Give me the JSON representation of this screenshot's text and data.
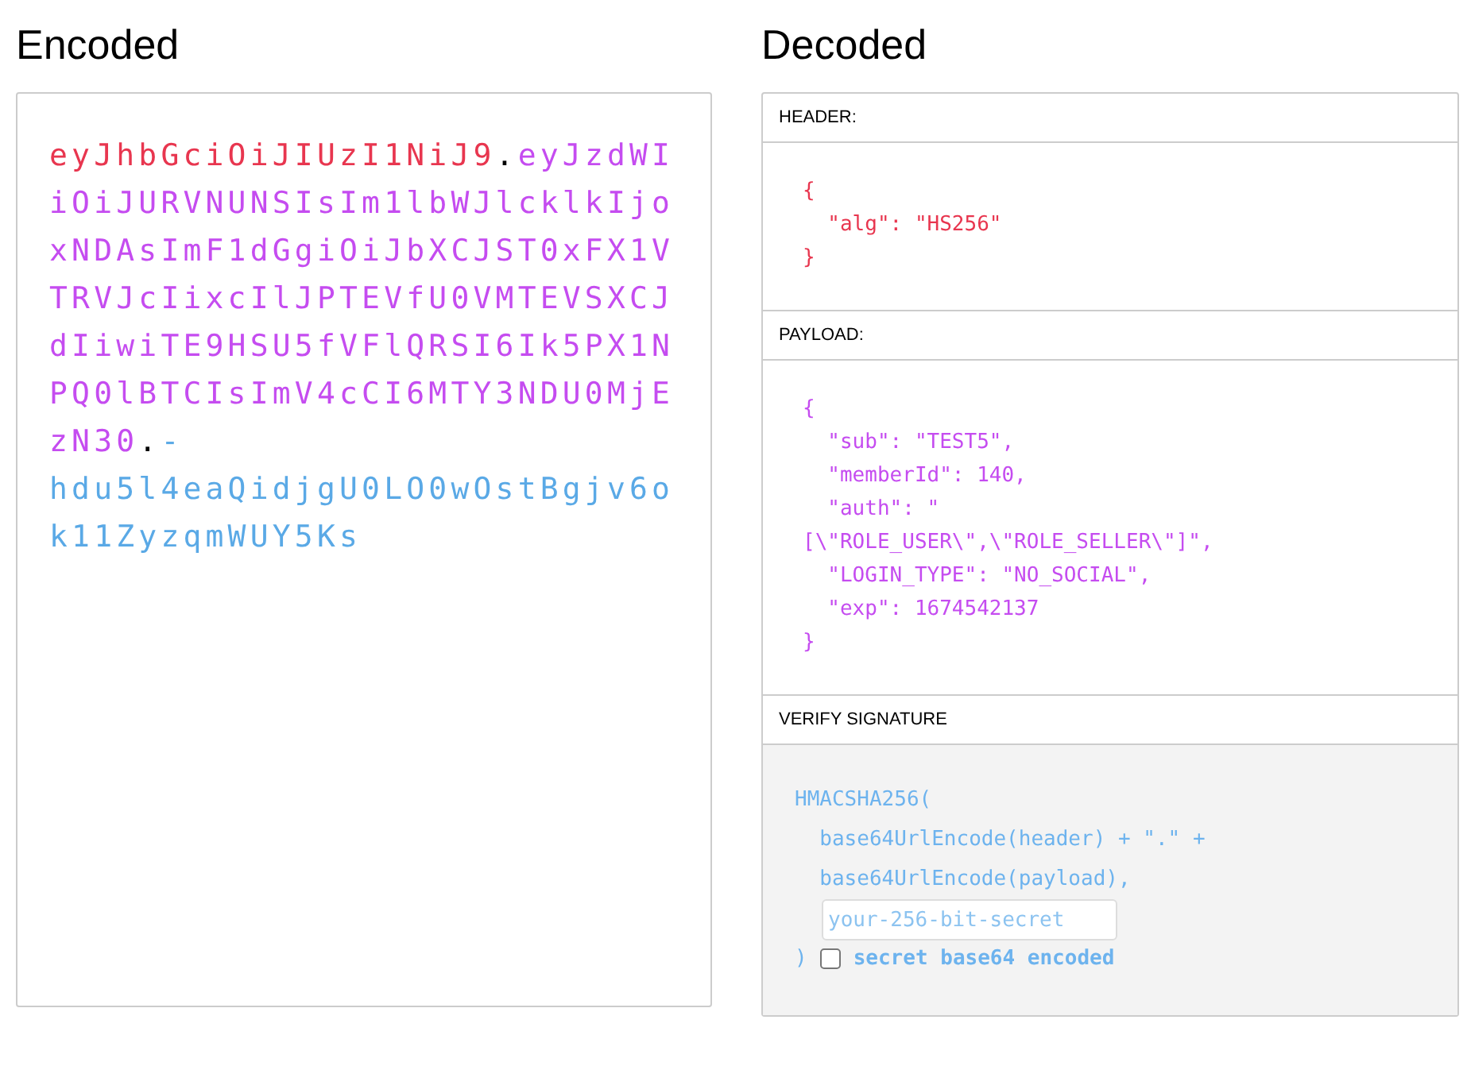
{
  "encoded": {
    "title": "Encoded",
    "segments": [
      {
        "kind": "header",
        "text": "eyJhbGciOiJIUzI1NiJ9"
      },
      {
        "kind": "dot",
        "text": "."
      },
      {
        "kind": "payload",
        "text": "eyJzdWIiOiJURVNUNSIsIm1lbWJlcklkIjoxNDAsImF1dGgiOiJbXCJST0xFX1VTRVJcIixcIlJPTEVfU0VMTEVSXCJdIiwiTE9HSU5fVFlQRSI6Ik5PX1NPQ0lBTCIsImV4cCI6MTY3NDU0MjEzN30"
      },
      {
        "kind": "dot",
        "text": "."
      },
      {
        "kind": "signature",
        "text": "-hdu5l4eaQidjgU0LO0wOstBgjv6ok11ZyzqmWUY5Ks"
      }
    ]
  },
  "decoded": {
    "title": "Decoded",
    "sections": [
      {
        "kind": "header",
        "label": "HEADER:",
        "lines": [
          "{",
          "  \"alg\": \"HS256\"",
          "}"
        ]
      },
      {
        "kind": "payload",
        "label": "PAYLOAD:",
        "lines": [
          "{",
          "  \"sub\": \"TEST5\",",
          "  \"memberId\": 140,",
          "  \"auth\": \"",
          "[\\\"ROLE_USER\\\",\\\"ROLE_SELLER\\\"]\",",
          "  \"LOGIN_TYPE\": \"NO_SOCIAL\",",
          "  \"exp\": 1674542137",
          "}"
        ]
      },
      {
        "kind": "verify",
        "label": "VERIFY SIGNATURE",
        "lines": [
          "HMACSHA256(",
          "  base64UrlEncode(header) + \".\" +",
          "  base64UrlEncode(payload),"
        ],
        "secret": {
          "placeholder": "your-256-bit-secret"
        },
        "close": ")",
        "base64": {
          "label": "secret base64 encoded",
          "checked": false
        }
      }
    ]
  }
}
